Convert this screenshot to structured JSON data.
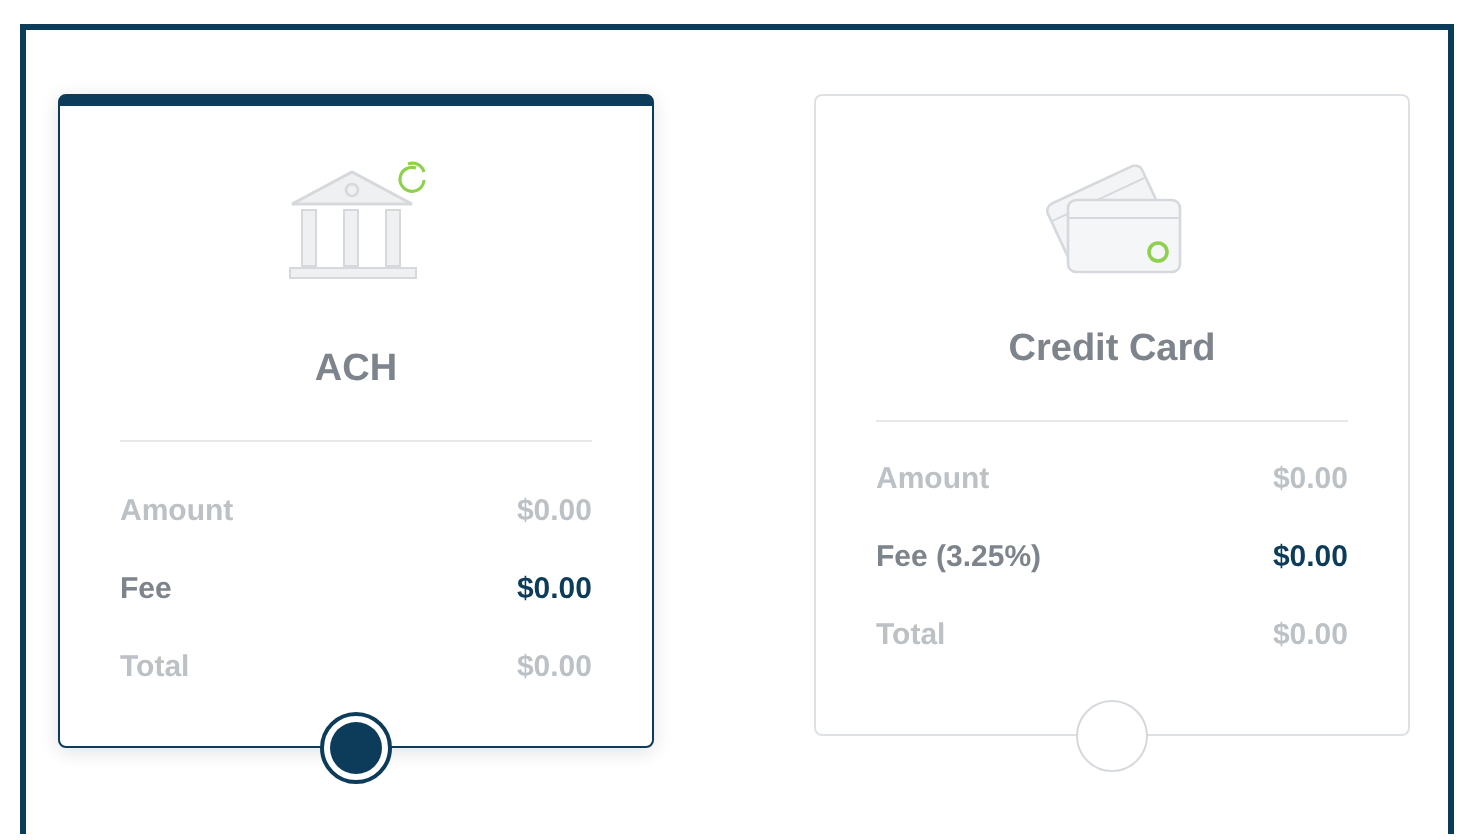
{
  "payment_methods": [
    {
      "kind": "bank",
      "title": "ACH",
      "selected": true,
      "rows": [
        {
          "label": "Amount",
          "value": "$0.00",
          "kind": "muted"
        },
        {
          "label": "Fee",
          "value": "$0.00",
          "kind": "strong"
        },
        {
          "label": "Total",
          "value": "$0.00",
          "kind": "muted"
        }
      ]
    },
    {
      "kind": "card",
      "title": "Credit Card",
      "selected": false,
      "rows": [
        {
          "label": "Amount",
          "value": "$0.00",
          "kind": "muted"
        },
        {
          "label": "Fee (3.25%)",
          "value": "$0.00",
          "kind": "strong"
        },
        {
          "label": "Total",
          "value": "$0.00",
          "kind": "muted"
        }
      ]
    }
  ]
}
